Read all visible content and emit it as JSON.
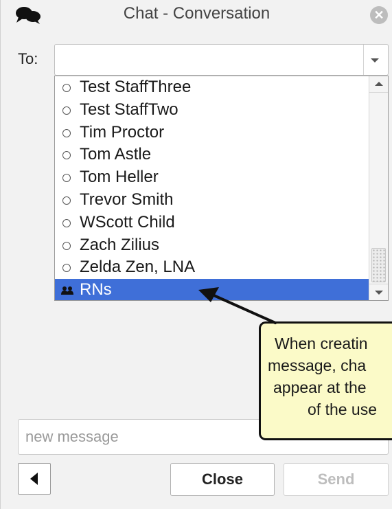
{
  "window": {
    "title": "Chat - Conversation",
    "close_glyph": "✕"
  },
  "to": {
    "label": "To:",
    "value": ""
  },
  "dropdown": {
    "options": [
      {
        "label": "Test StaffThree",
        "type": "user"
      },
      {
        "label": "Test StaffTwo",
        "type": "user"
      },
      {
        "label": "Tim Proctor",
        "type": "user"
      },
      {
        "label": "Tom Astle",
        "type": "user"
      },
      {
        "label": "Tom Heller",
        "type": "user"
      },
      {
        "label": "Trevor Smith",
        "type": "user"
      },
      {
        "label": "WScott Child",
        "type": "user"
      },
      {
        "label": "Zach Zilius",
        "type": "user"
      },
      {
        "label": "Zelda Zen, LNA",
        "type": "user"
      },
      {
        "label": "RNs",
        "type": "group",
        "selected": true
      }
    ],
    "selected_color": "#3f6fd8"
  },
  "message": {
    "placeholder": "new message",
    "value": ""
  },
  "buttons": {
    "close_label": "Close",
    "send_label": "Send"
  },
  "callout": {
    "lines": [
      "When creatin",
      "message, cha",
      "appear at the",
      "of the use"
    ],
    "background": "#fbfac8"
  },
  "icons": {
    "app": "chat-bubbles-icon",
    "close": "close-circle-icon",
    "dropdown": "chevron-down-icon",
    "radio": "radio-empty-icon",
    "group": "group-users-icon",
    "back": "back-triangle-icon"
  }
}
